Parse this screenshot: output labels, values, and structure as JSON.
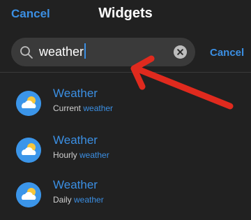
{
  "header": {
    "cancel_label": "Cancel",
    "title": "Widgets"
  },
  "search": {
    "value": "weather",
    "cancel_label": "Cancel"
  },
  "results": [
    {
      "title": "Weather",
      "subtitle_prefix": "Current ",
      "subtitle_match": "weather"
    },
    {
      "title": "Weather",
      "subtitle_prefix": "Hourly ",
      "subtitle_match": "weather"
    },
    {
      "title": "Weather",
      "subtitle_prefix": "Daily ",
      "subtitle_match": "weather"
    }
  ],
  "icons": {
    "search": "search-icon",
    "clear": "clear-icon",
    "weather": "weather-app-icon",
    "annotation": "red-arrow-annotation"
  },
  "colors": {
    "background": "#212121",
    "accent": "#3b8fe3",
    "search_field": "#3a3a3a",
    "annotation": "#e02a1e"
  }
}
